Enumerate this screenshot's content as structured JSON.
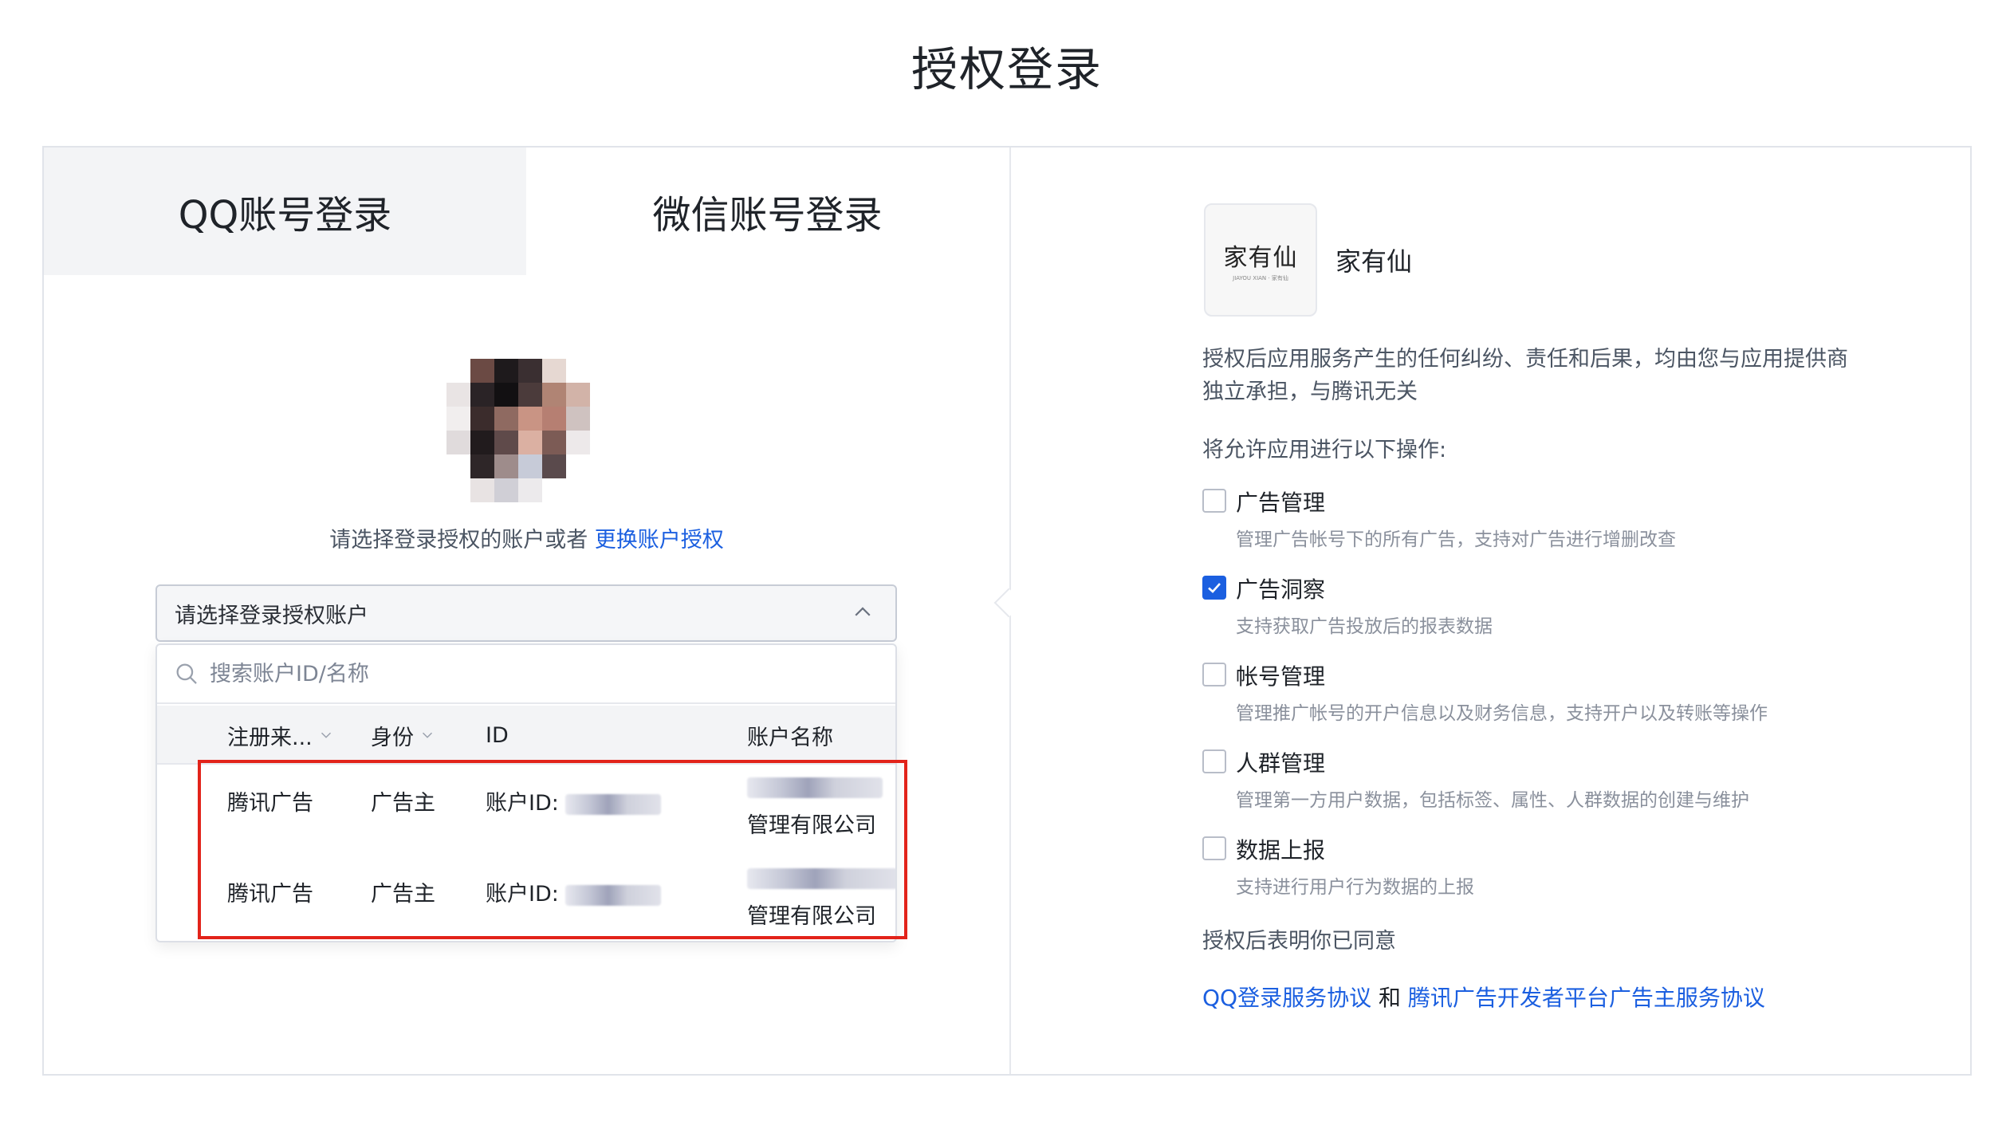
{
  "page": {
    "title": "授权登录"
  },
  "tabs": {
    "qq": "QQ账号登录",
    "wechat": "微信账号登录"
  },
  "login": {
    "prompt": "请选择登录授权的账户或者",
    "switch_link": "更换账户授权",
    "select_placeholder": "请选择登录授权账户",
    "search_placeholder": "搜索账户ID/名称"
  },
  "table": {
    "headers": {
      "source": "注册来...",
      "role": "身份",
      "id": "ID",
      "name": "账户名称"
    },
    "rows": [
      {
        "source": "腾讯广告",
        "role": "广告主",
        "id_label": "账户ID:",
        "name_suffix": "管理有限公司"
      },
      {
        "source": "腾讯广告",
        "role": "广告主",
        "id_label": "账户ID:",
        "name_suffix": "管理有限公司"
      }
    ]
  },
  "app": {
    "logo_text": "家有仙",
    "logo_subtext": "JIAYOU XIAN · 家有仙",
    "name": "家有仙"
  },
  "disclaimer": "授权后应用服务产生的任何纠纷、责任和后果，均由您与应用提供商独立承担，与腾讯无关",
  "allow_label": "将允许应用进行以下操作:",
  "permissions": [
    {
      "title": "广告管理",
      "desc": "管理广告帐号下的所有广告，支持对广告进行增删改查",
      "checked": false
    },
    {
      "title": "广告洞察",
      "desc": "支持获取广告投放后的报表数据",
      "checked": true
    },
    {
      "title": "帐号管理",
      "desc": "管理推广帐号的开户信息以及财务信息，支持开户以及转账等操作",
      "checked": false
    },
    {
      "title": "人群管理",
      "desc": "管理第一方用户数据，包括标签、属性、人群数据的创建与维护",
      "checked": false
    },
    {
      "title": "数据上报",
      "desc": "支持进行用户行为数据的上报",
      "checked": false
    }
  ],
  "agree_text": "授权后表明你已同意",
  "agreements": {
    "qq_link": "QQ登录服务协议",
    "and": "和",
    "platform_link": "腾讯广告开发者平台广告主服务协议"
  },
  "colors": {
    "accent": "#1b5fe0",
    "highlight": "#e2231a",
    "tab_active_bg": "#f3f4f6"
  }
}
